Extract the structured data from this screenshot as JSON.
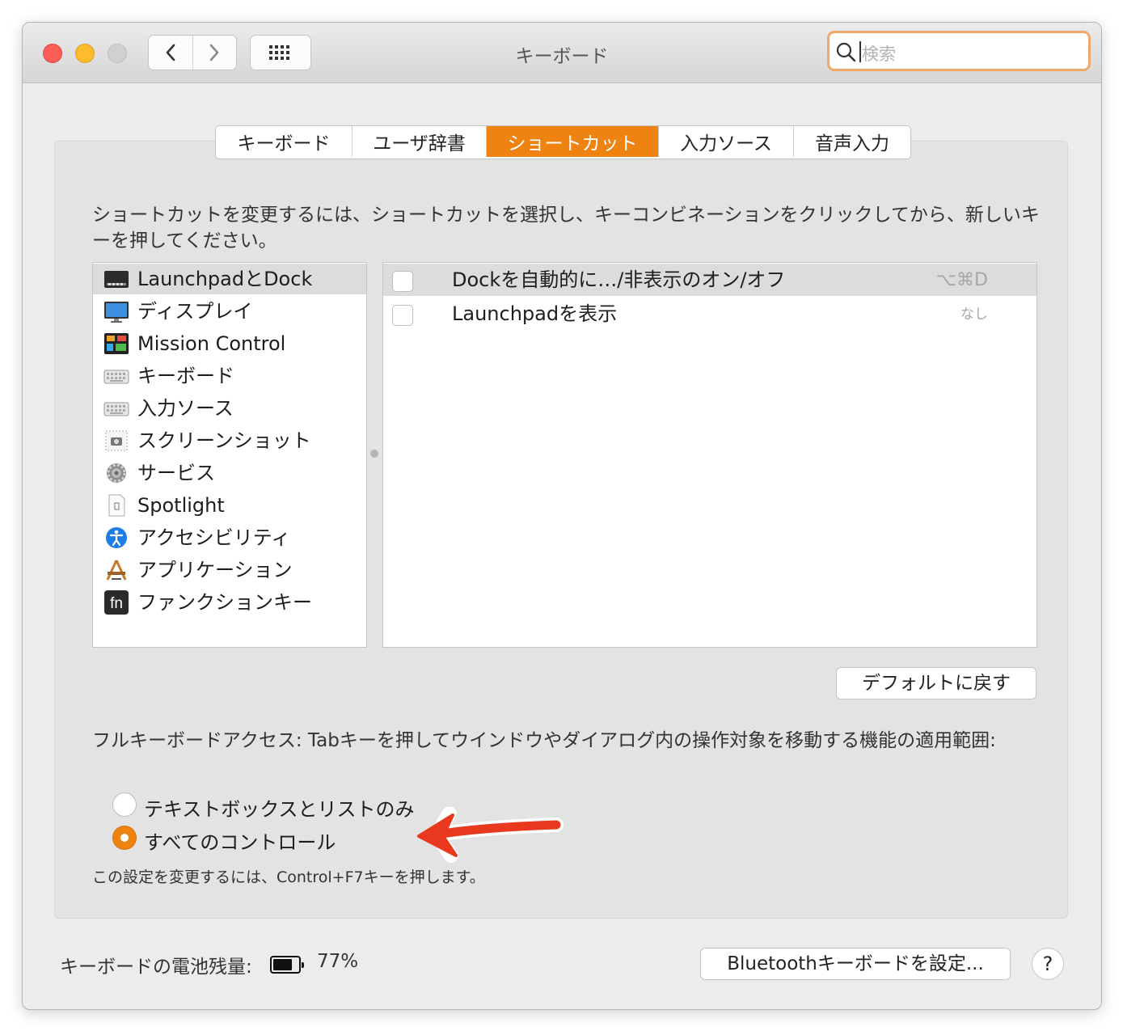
{
  "window": {
    "title": "キーボード",
    "search_placeholder": "検索"
  },
  "tabs": [
    {
      "label": "キーボード",
      "active": false
    },
    {
      "label": "ユーザ辞書",
      "active": false
    },
    {
      "label": "ショートカット",
      "active": true
    },
    {
      "label": "入力ソース",
      "active": false
    },
    {
      "label": "音声入力",
      "active": false
    }
  ],
  "description": "ショートカットを変更するには、ショートカットを選択し、キーコンビネーションをクリックしてから、新しいキーを押してください。",
  "categories": [
    {
      "label": "LaunchpadとDock",
      "icon": "launchpad-dock-icon",
      "selected": true
    },
    {
      "label": "ディスプレイ",
      "icon": "display-icon",
      "selected": false
    },
    {
      "label": "Mission Control",
      "icon": "mission-control-icon",
      "selected": false
    },
    {
      "label": "キーボード",
      "icon": "keyboard-icon",
      "selected": false
    },
    {
      "label": "入力ソース",
      "icon": "input-source-icon",
      "selected": false
    },
    {
      "label": "スクリーンショット",
      "icon": "screenshot-icon",
      "selected": false
    },
    {
      "label": "サービス",
      "icon": "gear-icon",
      "selected": false
    },
    {
      "label": "Spotlight",
      "icon": "spotlight-icon",
      "selected": false
    },
    {
      "label": "アクセシビリティ",
      "icon": "accessibility-icon",
      "selected": false
    },
    {
      "label": "アプリケーション",
      "icon": "applications-icon",
      "selected": false
    },
    {
      "label": "ファンクションキー",
      "icon": "fn-key-icon",
      "selected": false
    }
  ],
  "shortcuts": [
    {
      "name": "Dockを自動的に…/非表示のオン/オフ",
      "key": "⌥⌘D",
      "checked": false,
      "selected": true
    },
    {
      "name": "Launchpadを表示",
      "key": "なし",
      "checked": false,
      "selected": false
    }
  ],
  "default_button": "デフォルトに戻す",
  "full_keyboard_access": {
    "text": "フルキーボードアクセス: Tabキーを押してウインドウやダイアログ内の操作対象を移動する機能の適用範囲:",
    "options": [
      {
        "label": "テキストボックスとリストのみ",
        "selected": false
      },
      {
        "label": "すべてのコントロール",
        "selected": true
      }
    ],
    "note": "この設定を変更するには、Control+F7キーを押します。"
  },
  "battery": {
    "label": "キーボードの電池残量:",
    "percent_text": "77%",
    "level": 0.77
  },
  "bluetooth_button": "Bluetoothキーボードを設定...",
  "help_label": "?",
  "annotation_arrow_color": "#e8391e",
  "accent_color": "#ee8312"
}
